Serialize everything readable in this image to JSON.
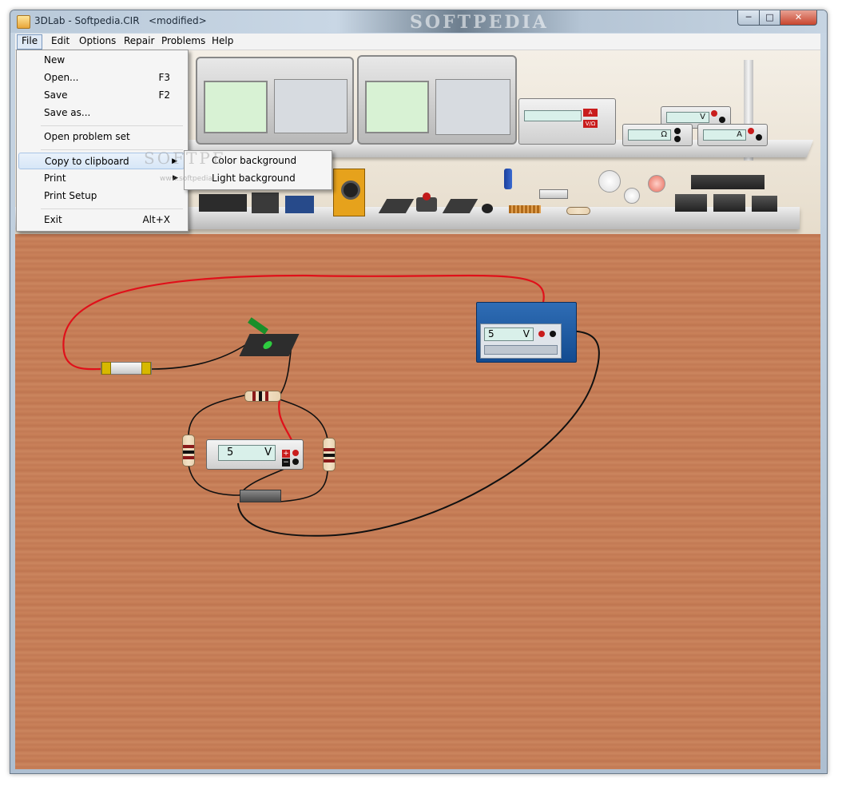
{
  "window": {
    "title": "3DLab - Softpedia.CIR   <modified>",
    "title_watermark": "SOFTPEDIA",
    "controls": {
      "minimize": "─",
      "maximize": "□",
      "close": "✕"
    }
  },
  "menubar": {
    "items": [
      {
        "label": "File"
      },
      {
        "label": "Edit"
      },
      {
        "label": "Options"
      },
      {
        "label": "Repair"
      },
      {
        "label": "Problems"
      },
      {
        "label": "Help"
      }
    ]
  },
  "file_menu": {
    "items": [
      {
        "label": "New",
        "shortcut": ""
      },
      {
        "label": "Open...",
        "shortcut": "F3"
      },
      {
        "label": "Save",
        "shortcut": "F2"
      },
      {
        "label": "Save as...",
        "shortcut": ""
      },
      {
        "label": "Open problem set",
        "shortcut": ""
      },
      {
        "label": "Copy to clipboard",
        "shortcut": "",
        "submenu": true
      },
      {
        "label": "Print",
        "shortcut": "",
        "submenu": true
      },
      {
        "label": "Print Setup",
        "shortcut": ""
      },
      {
        "label": "Exit",
        "shortcut": "Alt+X"
      }
    ],
    "highlighted": "Copy to clipboard"
  },
  "clipboard_submenu": {
    "items": [
      {
        "label": "Color background"
      },
      {
        "label": "Light background"
      }
    ]
  },
  "overlay_watermark": {
    "text": "SOFTPE",
    "url": "www.softpedia"
  },
  "shelf": {
    "dmm_labels": [
      "V",
      "Ω",
      "A"
    ],
    "dmm_jack_labels": [
      "A",
      "V/Ω"
    ]
  },
  "workbench": {
    "power_supply": {
      "display": "5",
      "unit": "V"
    },
    "voltmeter": {
      "display": "5",
      "unit": "V",
      "plus": "+",
      "minus": "−"
    }
  },
  "colors": {
    "bench_wood": "#c77e54",
    "wire_red": "#e0101a",
    "wire_black": "#111111",
    "psu_blue": "#1f5ca6"
  }
}
